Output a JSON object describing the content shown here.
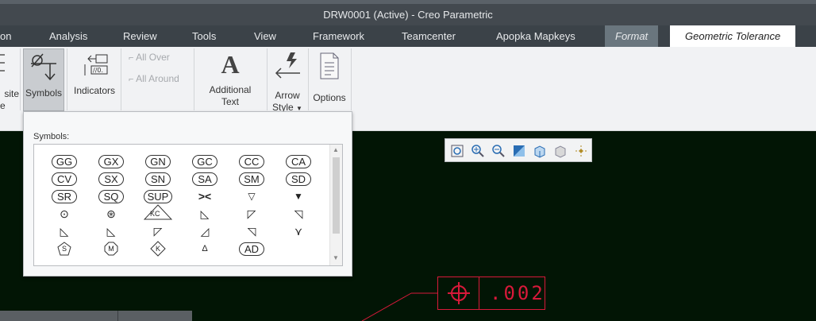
{
  "window": {
    "title": "DRW0001 (Active) - Creo Parametric"
  },
  "tabs": [
    {
      "label": "on"
    },
    {
      "label": "Analysis"
    },
    {
      "label": "Review"
    },
    {
      "label": "Tools"
    },
    {
      "label": "View"
    },
    {
      "label": "Framework"
    },
    {
      "label": "Teamcenter"
    },
    {
      "label": "Apopka Mapkeys"
    },
    {
      "label": "Format"
    },
    {
      "label": "Geometric Tolerance"
    }
  ],
  "ribbon": {
    "partial_left": [
      "site",
      "e"
    ],
    "symbols": "Symbols",
    "indicators": "Indicators",
    "all_over": "All Over",
    "all_around": "All Around",
    "additional_text": [
      "Additional",
      "Text"
    ],
    "arrow_style": [
      "Arrow",
      "Style"
    ],
    "options": "Options"
  },
  "symbols_panel": {
    "title": "Symbols:",
    "rows": [
      [
        "GG",
        "GX",
        "GN",
        "GC",
        "CC",
        "CA"
      ],
      [
        "CV",
        "SX",
        "SN",
        "SA",
        "SM",
        "SD"
      ],
      [
        "SR",
        "SQ",
        "SUP",
        "><",
        "▽",
        "▼"
      ],
      [
        "⊙",
        "⊛",
        "KC",
        "◺",
        "◸",
        "◹"
      ],
      [
        "◺",
        "◺",
        "◸",
        "◿",
        "◹",
        "⋎"
      ],
      [
        "S",
        "M",
        "K",
        "Δ",
        "AD",
        ""
      ]
    ]
  },
  "feature_control_frame": {
    "symbol": "position-icon",
    "value": ".002"
  },
  "colors": {
    "annotation": "#d8193a",
    "canvas": "#021505",
    "tabbar": "#3b4248"
  }
}
